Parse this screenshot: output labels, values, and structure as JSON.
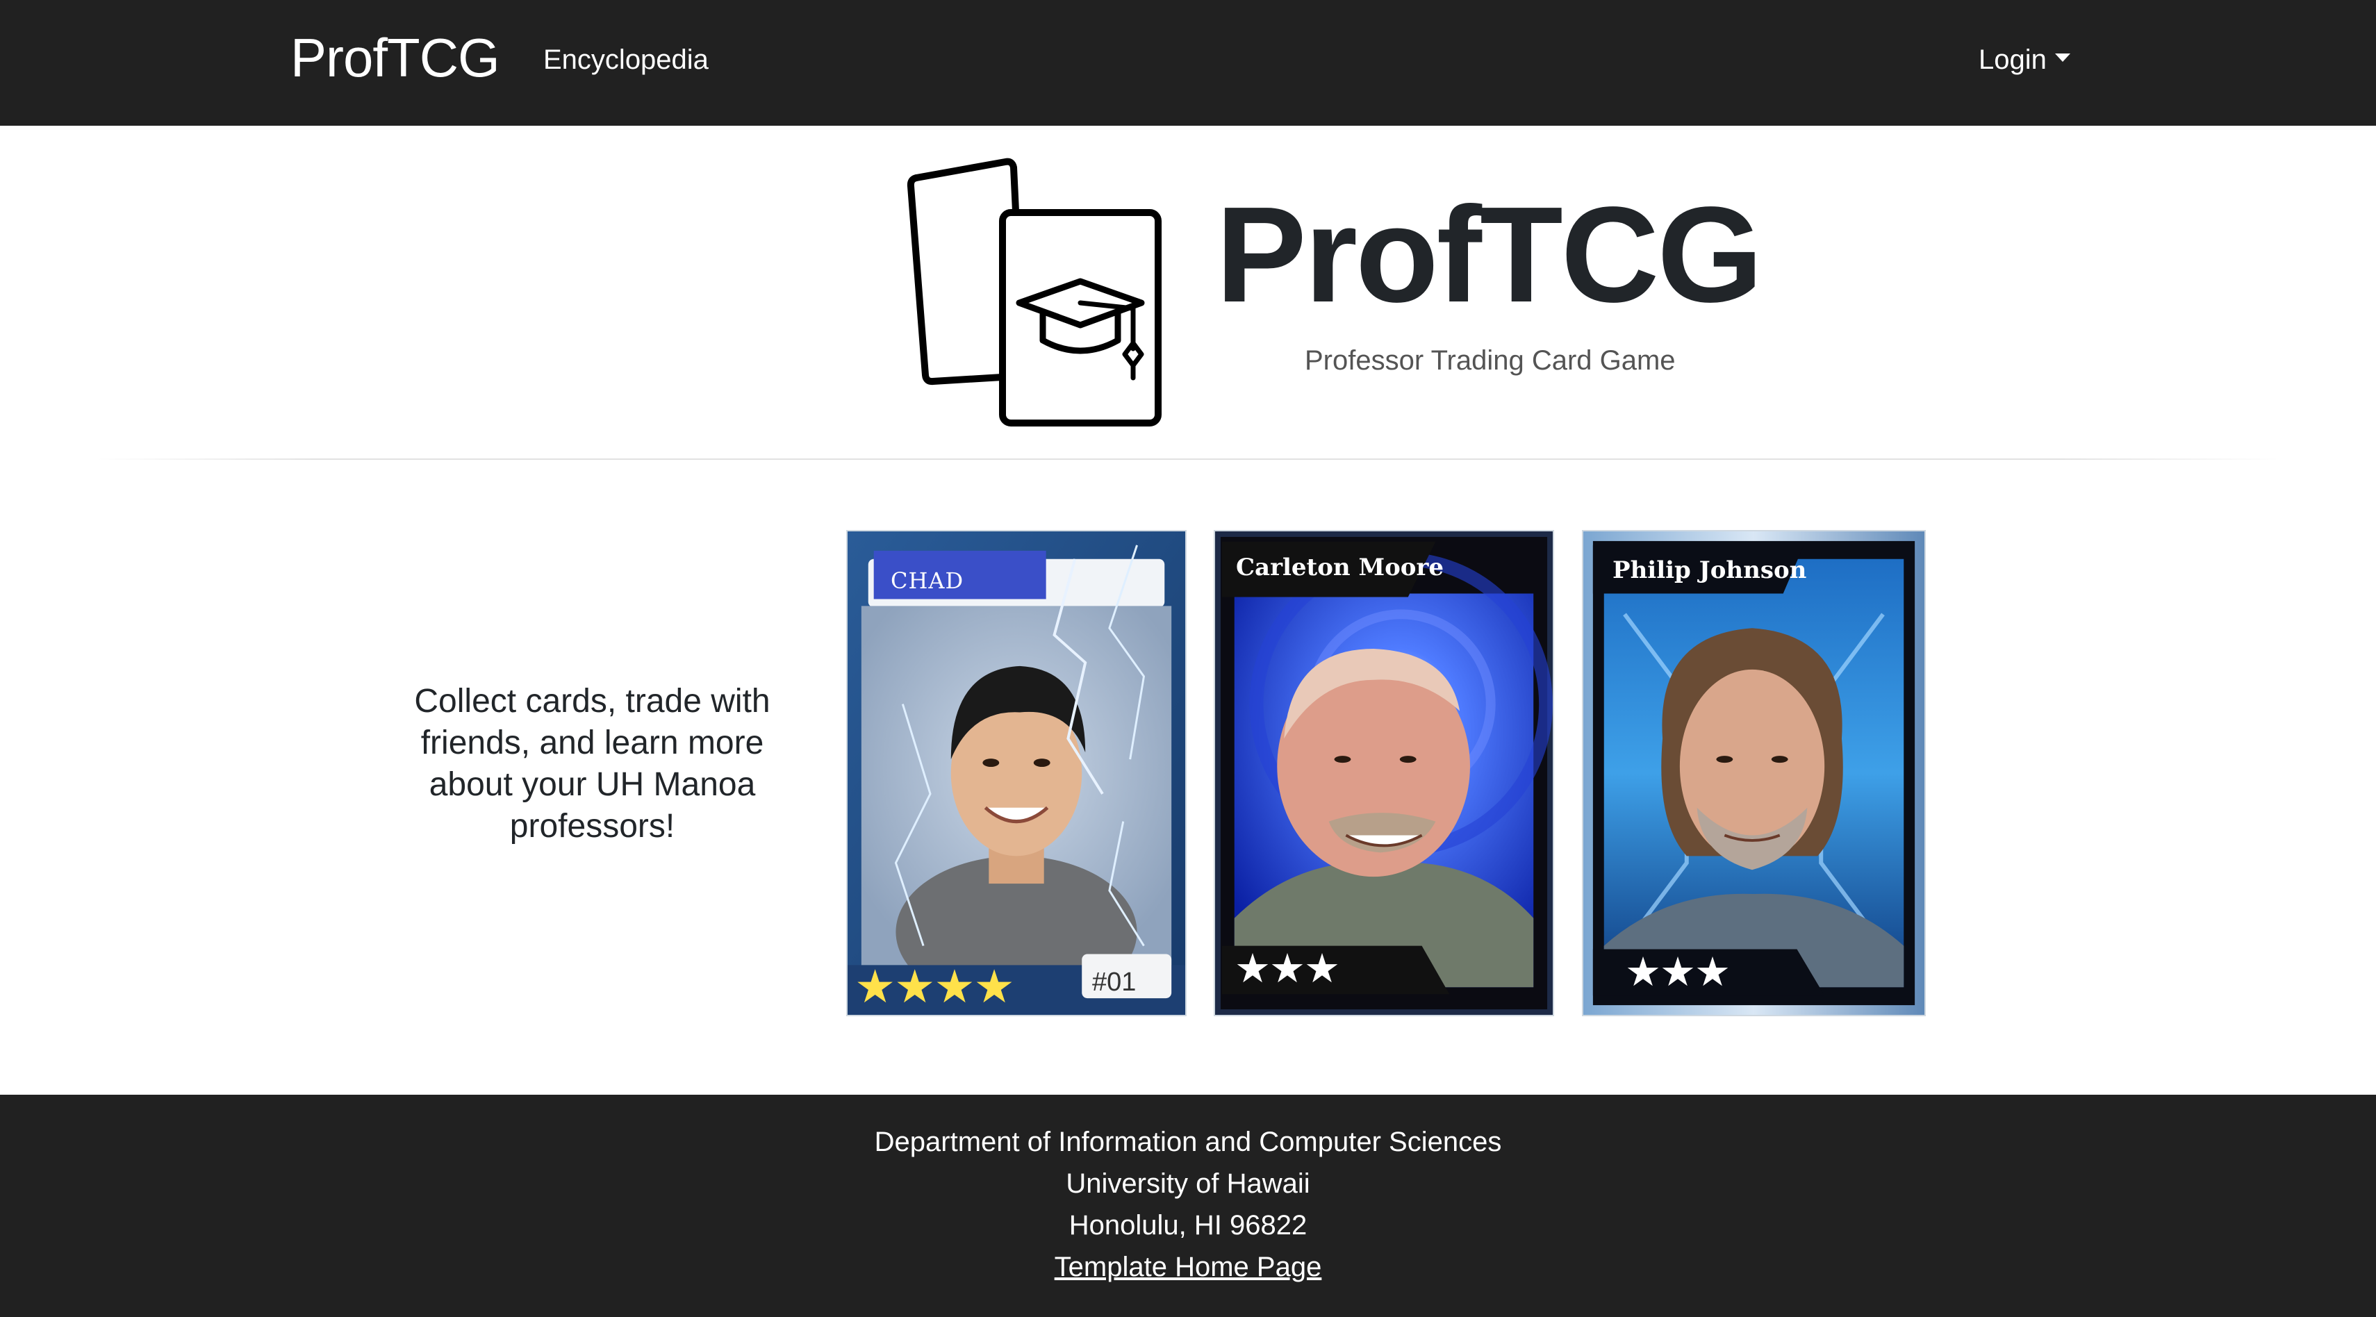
{
  "navbar": {
    "brand": "ProfTCG",
    "links": [
      {
        "label": "Encyclopedia"
      }
    ],
    "login_label": "Login"
  },
  "hero": {
    "title": "ProfTCG",
    "subtitle": "Professor Trading Card Game",
    "logo_icon": "cards-with-graduation-cap-icon"
  },
  "tagline": "Collect cards, trade with friends, and learn more about your UH Manoa professors!",
  "cards": [
    {
      "name": "CHAD",
      "stars": 4,
      "number": "#01"
    },
    {
      "name": "Carleton Moore",
      "stars": 3
    },
    {
      "name": "Philip Johnson",
      "stars": 3
    }
  ],
  "footer": {
    "department": "Department of Information and Computer Sciences",
    "university": "University of Hawaii",
    "address": "Honolulu, HI 96822",
    "link_label": "Template Home Page"
  },
  "colors": {
    "navbar_bg": "#212121",
    "footer_bg": "#212121",
    "star_yellow": "#ffe14a",
    "card_blue": "#1e4f8f"
  }
}
